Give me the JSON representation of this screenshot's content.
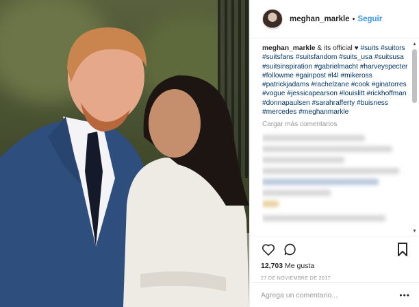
{
  "post": {
    "image_alt": "couple photo",
    "header": {
      "username": "meghan_markle",
      "separator": "•",
      "follow_label": "Seguir",
      "avatar_icon": "profile-avatar"
    },
    "caption": {
      "user": "meghan_markle",
      "text_before": "& its official",
      "heart": "♥",
      "hashtags": [
        "#suits",
        "#suitors",
        "#suitsfans",
        "#suitsfandom",
        "#suits_usa",
        "#suitsusa",
        "#suitsinspiration",
        "#gabrielmacht",
        "#harveyspecter",
        "#followme",
        "#gainpost",
        "#l4l",
        "#mikeross",
        "#patrickjadams",
        "#rachelzane",
        "#cook",
        "#ginatorres",
        "#vogue",
        "#jessicapearson",
        "#louislitt",
        "#rickhoffman",
        "#donnapaulsen",
        "#sarahrafferty",
        "#buisness",
        "#mercedes",
        "#meghanmarkle"
      ]
    },
    "load_more_label": "Cargar más comentarios",
    "likes": {
      "count": "12,703",
      "label": "Me gusta"
    },
    "date": "27 de noviembre de 2017",
    "comment_placeholder": "Agrega un comentario...",
    "more_label": "•••",
    "icons": {
      "like": "heart-icon",
      "comment": "comment-icon",
      "save": "bookmark-icon"
    },
    "colors": {
      "link": "#3897f0",
      "hashtag": "#003569",
      "text": "#262626",
      "muted": "#999999"
    }
  }
}
